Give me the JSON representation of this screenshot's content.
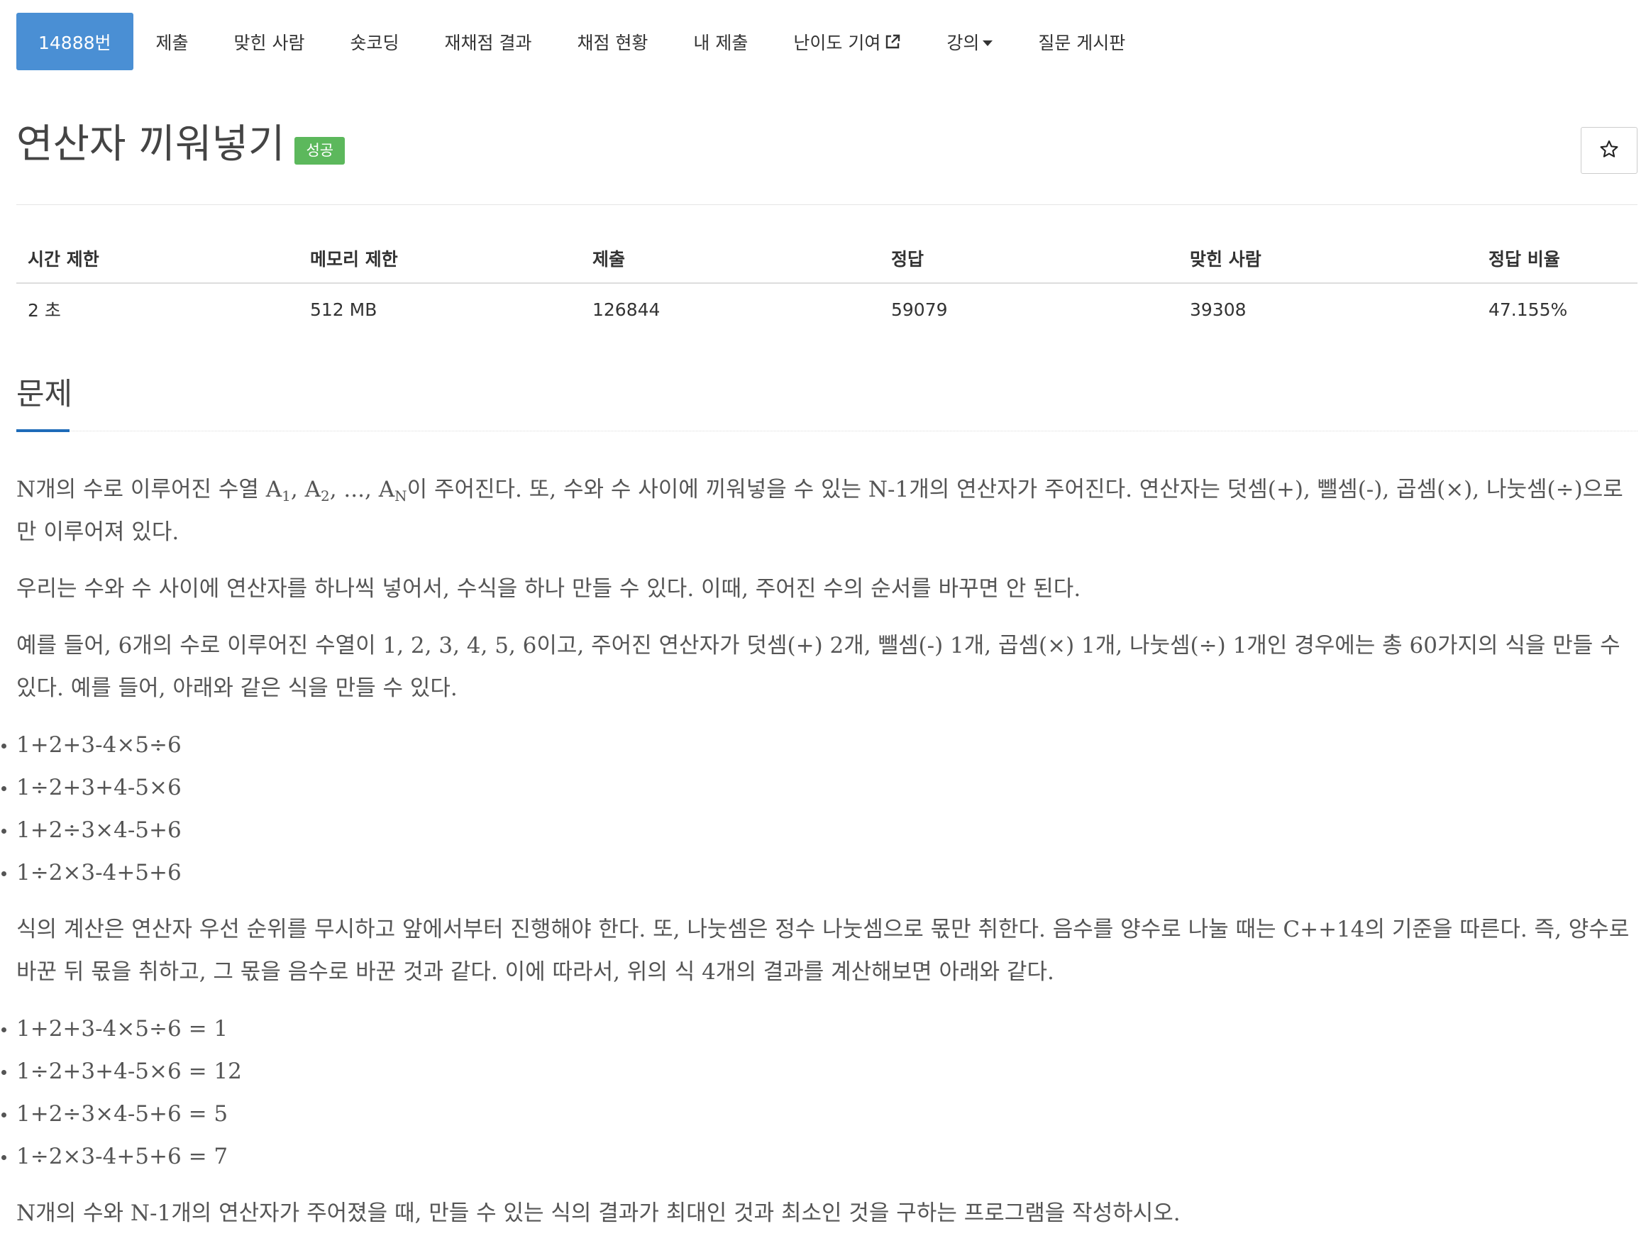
{
  "nav": {
    "tabs": [
      {
        "label": "14888번",
        "active": true
      },
      {
        "label": "제출"
      },
      {
        "label": "맞힌 사람"
      },
      {
        "label": "숏코딩"
      },
      {
        "label": "재채점 결과"
      },
      {
        "label": "채점 현황"
      },
      {
        "label": "내 제출"
      },
      {
        "label": "난이도 기여",
        "icon": "external-link-icon"
      },
      {
        "label": "강의",
        "icon": "caret-down-icon"
      },
      {
        "label": "질문 게시판"
      }
    ]
  },
  "problem": {
    "title": "연산자 끼워넣기",
    "status_badge": "성공",
    "status_color": "#5cb85c",
    "star_icon": "☆"
  },
  "info": {
    "headers": [
      "시간 제한",
      "메모리 제한",
      "제출",
      "정답",
      "맞힌 사람",
      "정답 비율"
    ],
    "values": [
      "2 초",
      "512 MB",
      "126844",
      "59079",
      "39308",
      "47.155%"
    ]
  },
  "section": {
    "heading": "문제"
  },
  "body": {
    "p1_a": "N개의 수로 이루어진 수열 A",
    "p1_sub1": "1",
    "p1_b": ", A",
    "p1_sub2": "2",
    "p1_c": ", ..., A",
    "p1_sub3": "N",
    "p1_d": "이 주어진다. 또, 수와 수 사이에 끼워넣을 수 있는 N-1개의 연산자가 주어진다. 연산자는 덧셈(+), 뺄셈(-), 곱셈(×), 나눗셈(÷)으로만 이루어져 있다.",
    "p2": "우리는 수와 수 사이에 연산자를 하나씩 넣어서, 수식을 하나 만들 수 있다. 이때, 주어진 수의 순서를 바꾸면 안 된다.",
    "p3": "예를 들어, 6개의 수로 이루어진 수열이 1, 2, 3, 4, 5, 6이고, 주어진 연산자가 덧셈(+) 2개, 뺄셈(-) 1개, 곱셈(×) 1개, 나눗셈(÷) 1개인 경우에는 총 60가지의 식을 만들 수 있다. 예를 들어, 아래와 같은 식을 만들 수 있다.",
    "list1": [
      "1+2+3-4×5÷6",
      "1÷2+3+4-5×6",
      "1+2÷3×4-5+6",
      "1÷2×3-4+5+6"
    ],
    "p4": "식의 계산은 연산자 우선 순위를 무시하고 앞에서부터 진행해야 한다. 또, 나눗셈은 정수 나눗셈으로 몫만 취한다. 음수를 양수로 나눌 때는 C++14의 기준을 따른다. 즉, 양수로 바꾼 뒤 몫을 취하고, 그 몫을 음수로 바꾼 것과 같다. 이에 따라서, 위의 식 4개의 결과를 계산해보면 아래와 같다.",
    "list2": [
      "1+2+3-4×5÷6 = 1",
      "1÷2+3+4-5×6 = 12",
      "1+2÷3×4-5+6 = 5",
      "1÷2×3-4+5+6 = 7"
    ],
    "p5": "N개의 수와 N-1개의 연산자가 주어졌을 때, 만들 수 있는 식의 결과가 최대인 것과 최소인 것을 구하는 프로그램을 작성하시오."
  },
  "colors": {
    "active_tab": "#4a8fd4",
    "section_underline": "#1e6bb8",
    "success": "#5cb85c"
  }
}
